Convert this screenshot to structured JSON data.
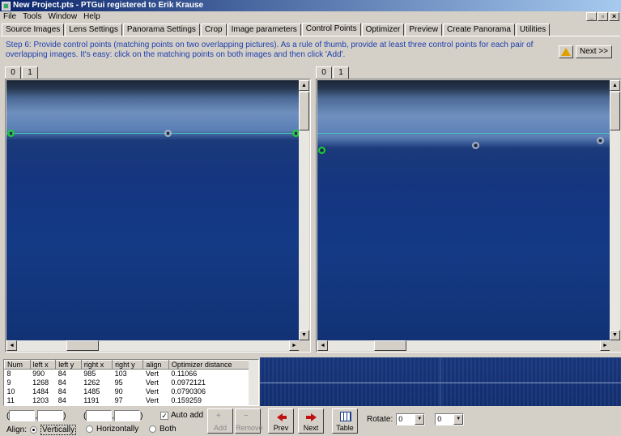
{
  "window": {
    "title": "New Project.pts - PTGui registered to Erik Krause"
  },
  "menu": [
    "File",
    "Tools",
    "Window",
    "Help"
  ],
  "window_controls": [
    "_",
    "▫",
    "×"
  ],
  "tabs": [
    "Source Images",
    "Lens Settings",
    "Panorama Settings",
    "Crop",
    "Image parameters",
    "Control Points",
    "Optimizer",
    "Preview",
    "Create Panorama",
    "Utilities"
  ],
  "active_tab": "Control Points",
  "instructions": "Step 6: Provide control points (matching points on two overlapping pictures). As a rule of thumb, provide at least three control points for each pair of overlapping images. It's easy: click on the matching points on both images and then click 'Add'.",
  "next_top_label": "Next >>",
  "left_viewer": {
    "tabs": [
      "0",
      "1"
    ],
    "active": "0"
  },
  "right_viewer": {
    "tabs": [
      "0",
      "1"
    ],
    "active": "1"
  },
  "cp_table": {
    "columns": [
      "Num",
      "left x",
      "left y",
      "right x",
      "right y",
      "align",
      "Optimizer distance"
    ],
    "rows": [
      [
        "8",
        "990",
        "84",
        "985",
        "103",
        "Vert",
        "0.11066"
      ],
      [
        "9",
        "1268",
        "84",
        "1262",
        "95",
        "Vert",
        "0.0972121"
      ],
      [
        "10",
        "1484",
        "84",
        "1485",
        "90",
        "Vert",
        "0.0790306"
      ],
      [
        "11",
        "1203",
        "84",
        "1191",
        "97",
        "Vert",
        "0.159259"
      ]
    ]
  },
  "controls": {
    "auto_add_label": "Auto add",
    "align_label": "Align:",
    "vertically_label": "Vertically",
    "horizontally_label": "Horizontally",
    "both_label": "Both",
    "add_label": "Add",
    "remove_label": "Remove",
    "prev_label": "Prev",
    "next_label": "Next",
    "table_label": "Table",
    "rotate_label": "Rotate:",
    "rotate_left_value": "0",
    "rotate_right_value": "0"
  }
}
